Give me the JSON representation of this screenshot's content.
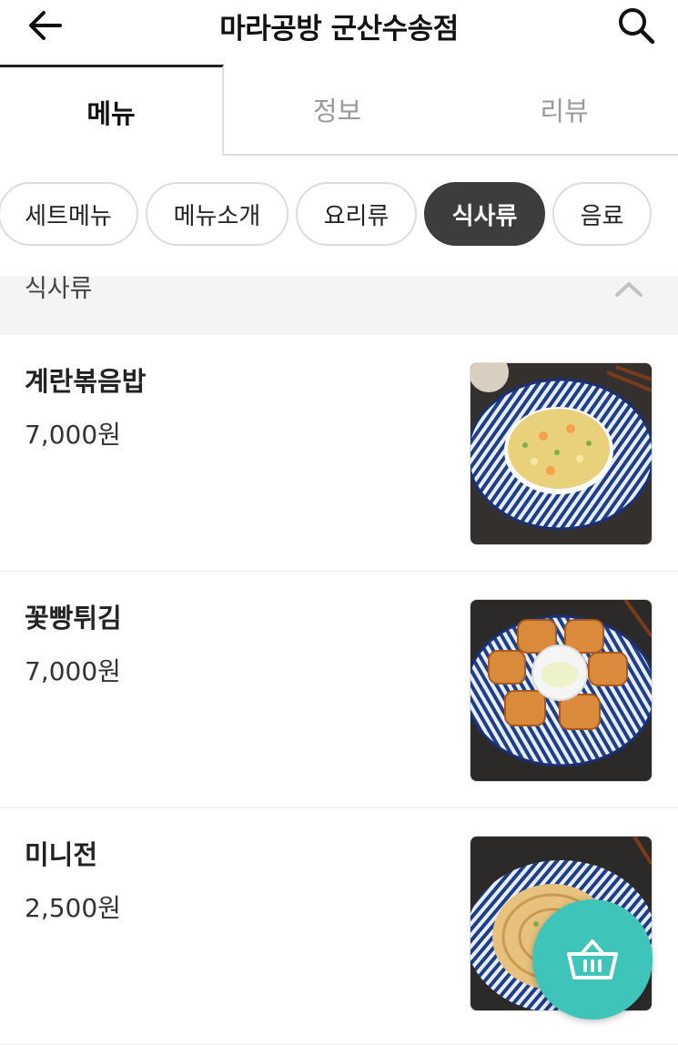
{
  "header": {
    "title": "마라공방 군산수송점",
    "back_icon": "arrow-left-icon",
    "search_icon": "search-icon"
  },
  "tabs": [
    {
      "label": "메뉴",
      "active": true
    },
    {
      "label": "정보",
      "active": false
    },
    {
      "label": "리뷰",
      "active": false
    }
  ],
  "categories": [
    {
      "label": "세트메뉴",
      "active": false
    },
    {
      "label": "메뉴소개",
      "active": false
    },
    {
      "label": "요리류",
      "active": false
    },
    {
      "label": "식사류",
      "active": true
    },
    {
      "label": "음료",
      "active": false
    }
  ],
  "section": {
    "title": "식사류",
    "toggle_icon": "chevron-up-icon"
  },
  "menu_items": [
    {
      "name": "계란볶음밥",
      "price": "7,000원",
      "photo": "fried-rice-photo"
    },
    {
      "name": "꽃빵튀김",
      "price": "7,000원",
      "photo": "fried-buns-photo"
    },
    {
      "name": "미니전",
      "price": "2,500원",
      "photo": "mini-pancake-photo"
    }
  ],
  "cart": {
    "icon": "basket-icon"
  },
  "colors": {
    "accent": "#3ec4b8",
    "active_chip": "#3d3d3d",
    "inactive_tab_text": "#9a9a9a",
    "plate_blue": "#1f3e8a"
  }
}
